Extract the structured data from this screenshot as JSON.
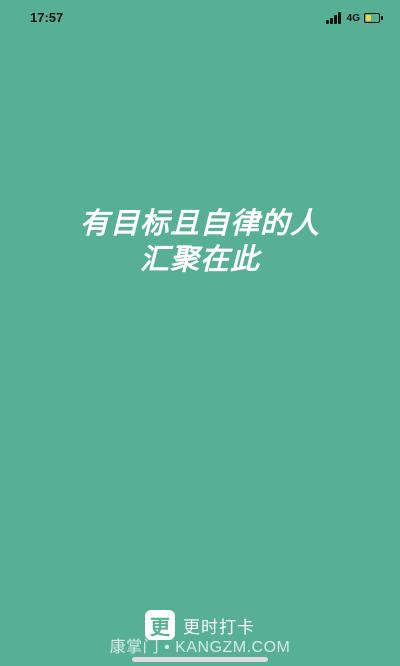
{
  "status_bar": {
    "time": "17:57",
    "network": "4G",
    "icons": [
      "signal-icon",
      "battery-charging-icon"
    ]
  },
  "splash": {
    "slogan_line1": "有目标且自律的人",
    "slogan_line2": "汇聚在此",
    "background_color": "#57b094"
  },
  "brand": {
    "logo_char": "更",
    "name": "更时打卡"
  },
  "watermark": "康掌门 • KANGZM.COM"
}
